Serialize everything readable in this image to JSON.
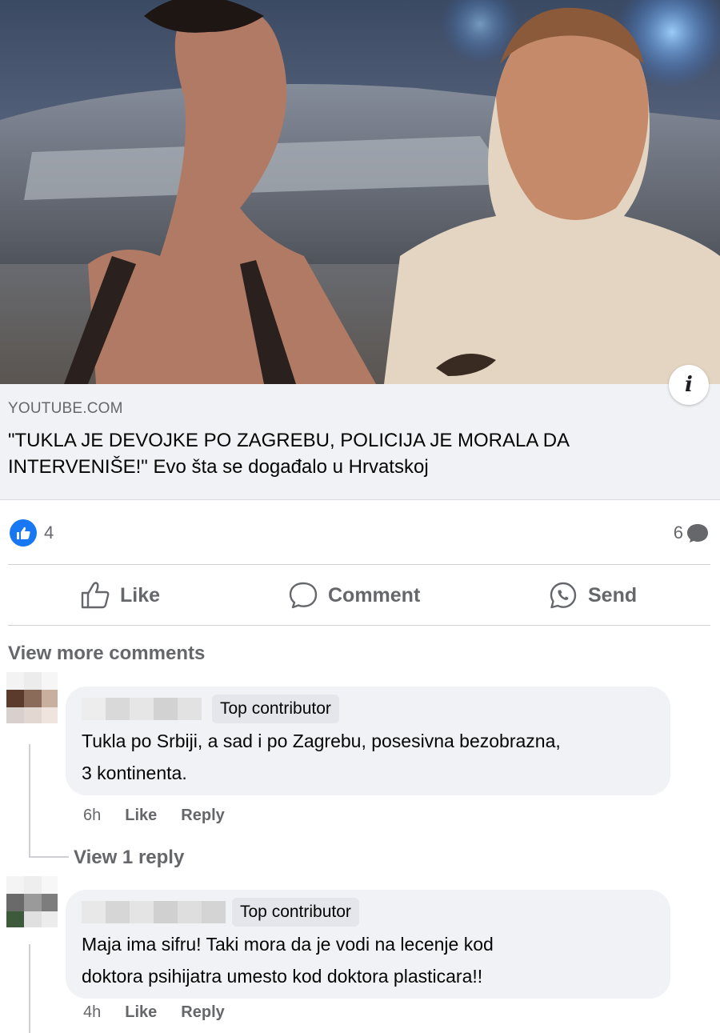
{
  "link_preview": {
    "domain": "YOUTUBE.COM",
    "title": "\"TUKLA JE DEVOJKE PO ZAGREBU, POLICIJA JE MORALA DA INTERVENIŠE!\" Evo šta se događalo u Hrvatskoj",
    "info_icon": "info-icon"
  },
  "reactions": {
    "like_count": "4",
    "comment_count": "6"
  },
  "actions": {
    "like": "Like",
    "comment": "Comment",
    "send": "Send"
  },
  "view_more_comments": "View more comments",
  "comments": [
    {
      "badge": "Top contributor",
      "text_line1": "Tukla po Srbiji, a sad i po Zagrebu, posesivna bezobrazna,",
      "text_line2": "3 kontinenta.",
      "time": "6h",
      "like": "Like",
      "reply": "Reply"
    },
    {
      "badge": "Top contributor",
      "text_line1": "Maja ima sifru! Taki mora da je vodi na lecenje kod",
      "text_line2": "doktora psihijatra umesto kod doktora plasticara!!",
      "time": "4h",
      "like": "Like",
      "reply": "Reply"
    }
  ],
  "view_reply": "View 1 reply",
  "colors": {
    "facebook_blue": "#1877f2",
    "secondary_text": "#65676b",
    "bubble_bg": "#f0f2f5"
  }
}
